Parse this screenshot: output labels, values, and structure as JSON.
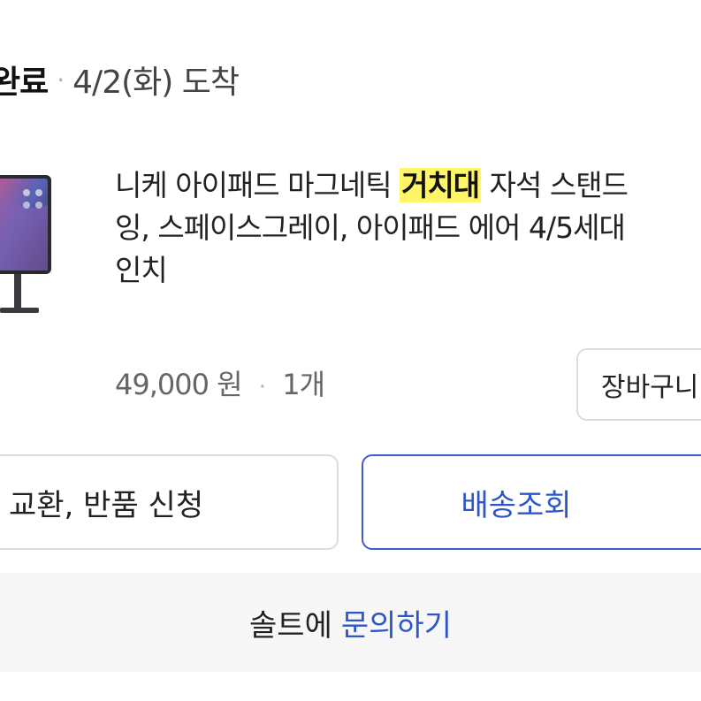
{
  "status": {
    "done_label": "완료",
    "date_text": "4/2(화) 도착"
  },
  "product": {
    "title_line1_before": "니케 아이패드 마그네틱 ",
    "title_highlight": "거치대",
    "title_line1_after": " 자석 스탠드",
    "title_line2": "잉, 스페이스그레이, 아이패드 에어 4/5세대",
    "title_line3": "인치",
    "price": "49,000 원",
    "quantity": "1개"
  },
  "buttons": {
    "cart": "장바구니",
    "exchange_return": "교환, 반품 신청",
    "track_delivery": "배송조회"
  },
  "inquiry": {
    "prefix": "솔트에",
    "link": "문의하기"
  },
  "colors": {
    "accent": "#2f56c8",
    "highlight": "#fff566"
  }
}
